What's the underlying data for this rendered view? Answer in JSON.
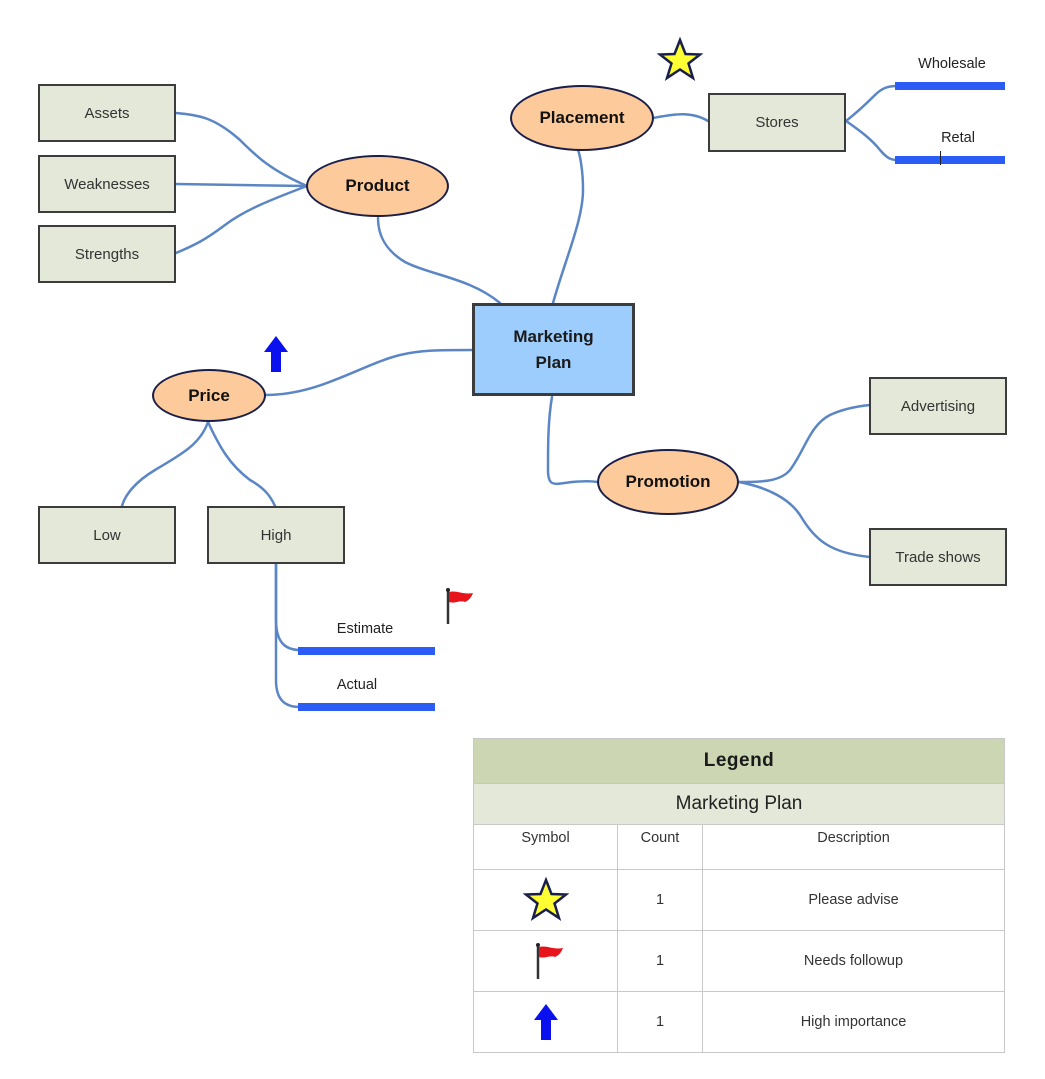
{
  "diagram": {
    "title": "Marketing Plan",
    "central": {
      "label": "Marketing Plan",
      "line1": "Marketing",
      "line2": "Plan"
    },
    "topics": {
      "product": {
        "label": "Product",
        "children": [
          "Assets",
          "Weaknesses",
          "Strengths"
        ]
      },
      "placement": {
        "label": "Placement",
        "marker": "star-icon",
        "children": [
          "Stores"
        ],
        "stores_children": [
          "Wholesale",
          "Retal"
        ]
      },
      "price": {
        "label": "Price",
        "marker": "arrow-up-icon",
        "children": [
          "Low",
          "High"
        ],
        "high_children": [
          "Estimate",
          "Actual"
        ],
        "high_marker": "flag-icon"
      },
      "promotion": {
        "label": "Promotion",
        "children": [
          "Advertising",
          "Trade shows"
        ]
      }
    },
    "colors": {
      "connector": "#5b86c5",
      "central_fill": "#9dcdfc",
      "topic_fill": "#fdca9b",
      "subtopic_fill": "#e3e8d8",
      "bar": "#2b5cf5",
      "star": "#ffff33",
      "flag": "#e8141c",
      "arrow": "#0a10ee"
    }
  },
  "legend": {
    "title": "Legend",
    "subtitle": "Marketing Plan",
    "headers": [
      "Symbol",
      "Count",
      "Description"
    ],
    "rows": [
      {
        "symbol": "star-icon",
        "count": "1",
        "description": "Please advise"
      },
      {
        "symbol": "flag-icon",
        "count": "1",
        "description": "Needs followup"
      },
      {
        "symbol": "arrow-up-icon",
        "count": "1",
        "description": "High importance"
      }
    ]
  }
}
